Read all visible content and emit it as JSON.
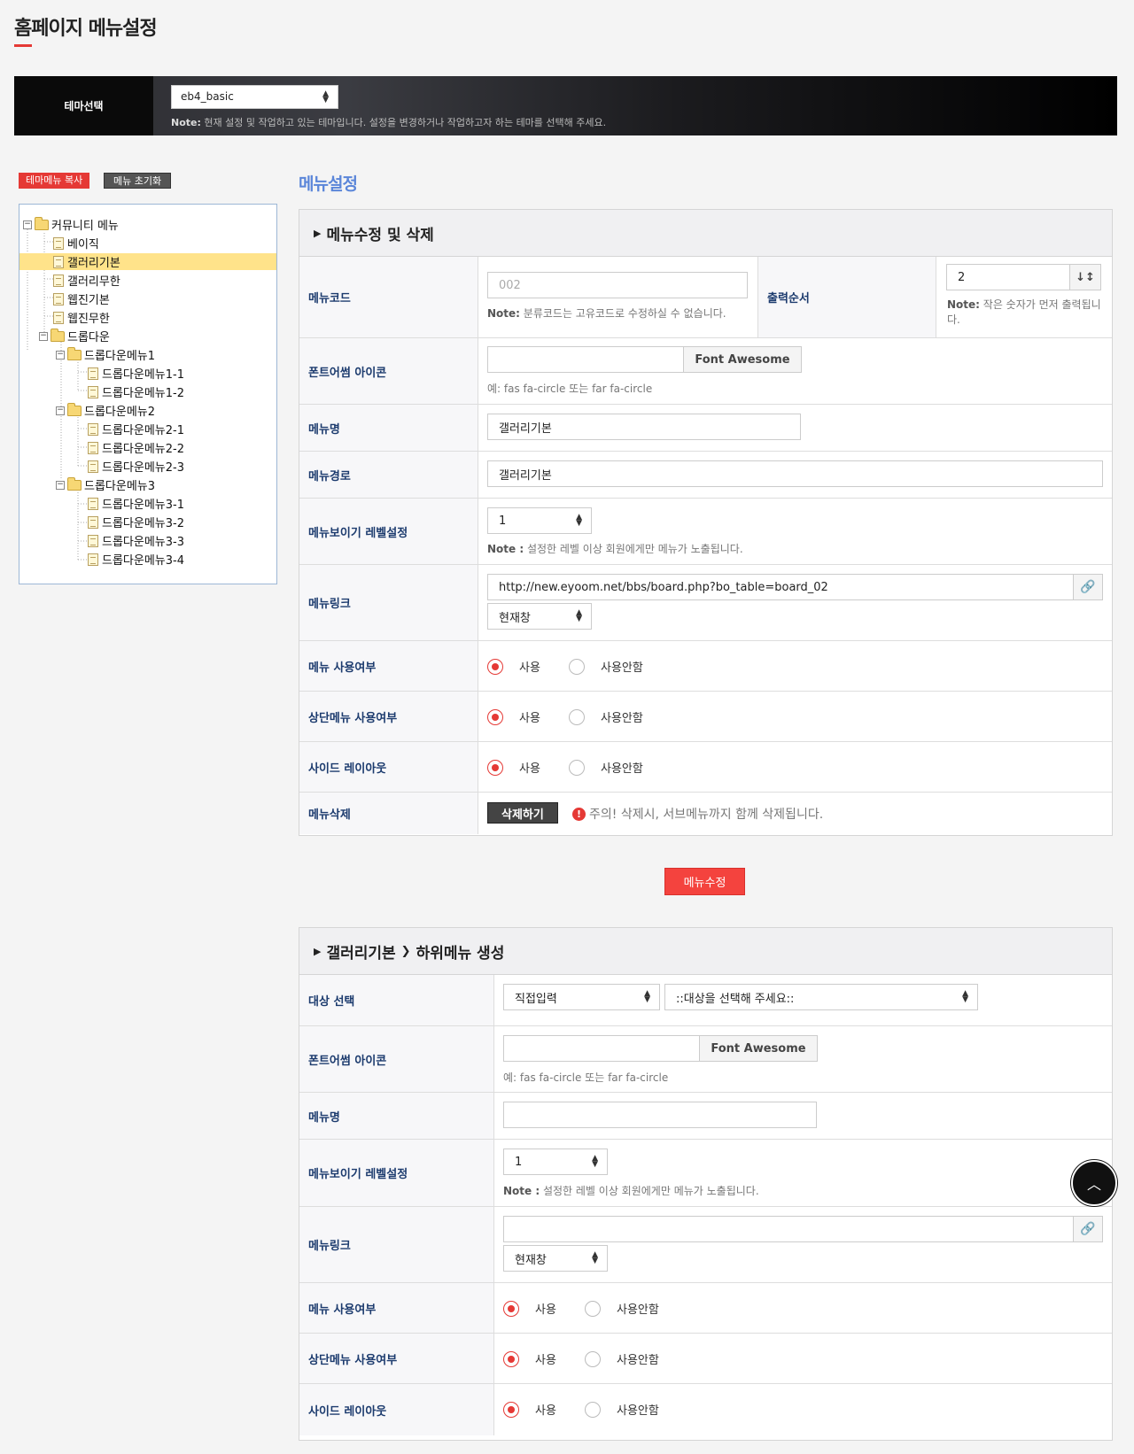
{
  "page": {
    "title": "홈페이지 메뉴설정"
  },
  "theme": {
    "label": "테마선택",
    "selected": "eb4_basic",
    "note_bold": "Note:",
    "note_text": " 현재 설정 및 작업하고 있는 테마입니다. 설정을 변경하거나 작업하고자 하는 테마를 선택해 주세요."
  },
  "tree_actions": {
    "copy_label": "테마메뉴 복사",
    "reset_label": "메뉴 초기화"
  },
  "tree": {
    "root": "커뮤니티 메뉴",
    "items": [
      "베이직",
      "갤러리기본",
      "갤러리무한",
      "웹진기본",
      "웹진무한",
      "드롭다운",
      "드롭다운메뉴1",
      "드롭다운메뉴1-1",
      "드롭다운메뉴1-2",
      "드롭다운메뉴2",
      "드롭다운메뉴2-1",
      "드롭다운메뉴2-2",
      "드롭다운메뉴2-3",
      "드롭다운메뉴3",
      "드롭다운메뉴3-1",
      "드롭다운메뉴3-2",
      "드롭다운메뉴3-3",
      "드롭다운메뉴3-4"
    ],
    "selected": "갤러리기본"
  },
  "section_title": "메뉴설정",
  "edit_form": {
    "heading": "메뉴수정 및 삭제",
    "code_label": "메뉴코드",
    "code_value": "002",
    "code_note_bold": "Note:",
    "code_note": " 분류코드는 고유코드로 수정하실 수 없습니다.",
    "order_label": "출력순서",
    "order_value": "2",
    "order_note_bold": "Note:",
    "order_note": " 작은 숫자가 먼저 출력됩니다.",
    "icon_label": "폰트어썸 아이콘",
    "icon_button": "Font Awesome",
    "icon_example": "예: fas fa-circle 또는 far fa-circle",
    "name_label": "메뉴명",
    "name_value": "갤러리기본",
    "path_label": "메뉴경로",
    "path_value": "갤러리기본",
    "level_label": "메뉴보이기 레벨설정",
    "level_value": "1",
    "level_note_bold": "Note :",
    "level_note": " 설정한 레벨 이상 회원에게만 메뉴가 노출됩니다.",
    "link_label": "메뉴링크",
    "link_value": "http://new.eyoom.net/bbs/board.php?bo_table=board_02",
    "target_value": "현재창",
    "use_label": "메뉴 사용여부",
    "top_use_label": "상단메뉴 사용여부",
    "side_label": "사이드 레이아웃",
    "opt_yes": "사용",
    "opt_no": "사용안함",
    "delete_label": "메뉴삭제",
    "delete_button": "삭제하기",
    "delete_warning": "주의! 삭제시, 서브메뉴까지 함께 삭제됩니다."
  },
  "submit_label": "메뉴수정",
  "sub_form": {
    "heading_parent": "갤러리기본",
    "heading_rest": "하위메뉴 생성",
    "target_label": "대상 선택",
    "target_mode": "직접입력",
    "target_placeholder": "::대상을 선택해 주세요::",
    "icon_label": "폰트어썸 아이콘",
    "icon_button": "Font Awesome",
    "icon_example": "예: fas fa-circle 또는 far fa-circle",
    "name_label": "메뉴명",
    "level_label": "메뉴보이기 레벨설정",
    "level_value": "1",
    "level_note_bold": "Note :",
    "level_note": " 설정한 레벨 이상 회원에게만 메뉴가 노출됩니다.",
    "link_label": "메뉴링크",
    "target_value": "현재창",
    "use_label": "메뉴 사용여부",
    "top_use_label": "상단메뉴 사용여부",
    "side_label": "사이드 레이아웃",
    "opt_yes": "사용",
    "opt_no": "사용안함"
  },
  "colors": {
    "accent": "#e53935",
    "label_text": "#1c3b6e",
    "section_title": "#5b86d9"
  },
  "icons": {
    "scroll_top": "chevron-up-icon",
    "link": "link-icon",
    "sort": "sort-numeric-icon",
    "warning": "exclamation-circle-icon"
  }
}
